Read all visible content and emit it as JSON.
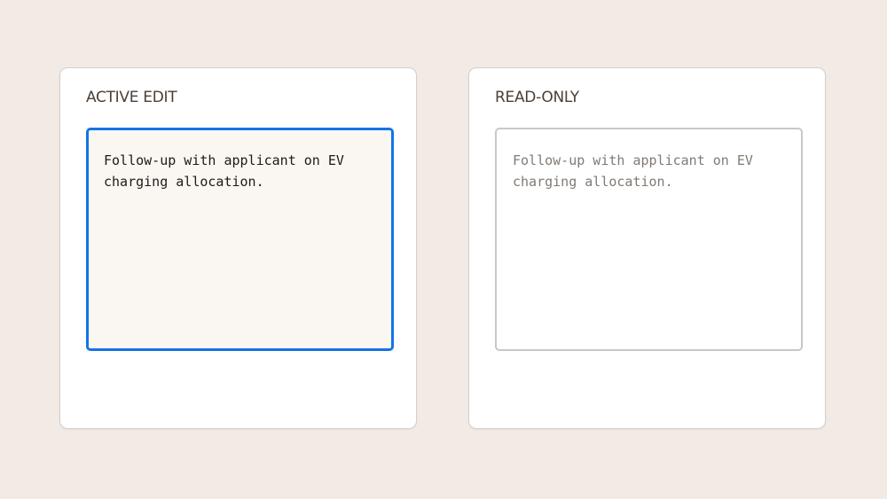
{
  "panels": [
    {
      "title": "ACTIVE EDIT",
      "state": "active",
      "text": "Follow-up with applicant on EV\ncharging allocation."
    },
    {
      "title": "READ-ONLY",
      "state": "readonly",
      "text": "Follow-up with applicant on EV\ncharging allocation."
    }
  ],
  "colors": {
    "background": "#f2ebe5",
    "focus_border": "#1473e6",
    "readonly_border": "#cbc7c3",
    "readonly_text": "#817a74"
  }
}
